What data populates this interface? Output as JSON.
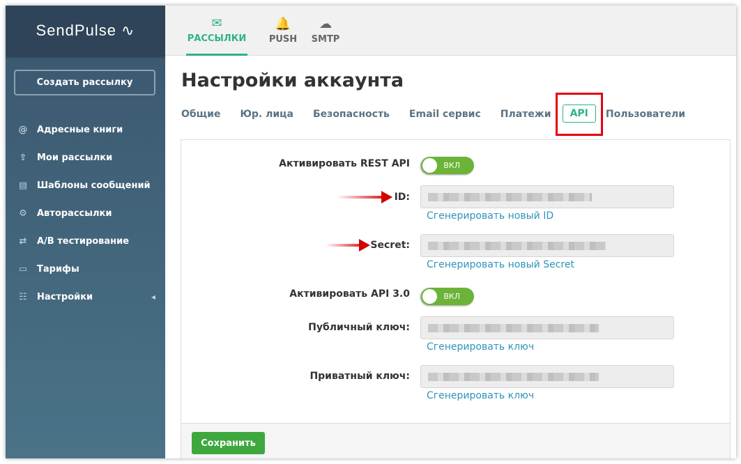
{
  "logo": "SendPulse",
  "sidebar": {
    "create_label": "Создать рассылку",
    "items": [
      {
        "label": "Адресные книги",
        "icon": "address-book-icon",
        "glyph": "@"
      },
      {
        "label": "Мои рассылки",
        "icon": "send-icon",
        "glyph": "⇪"
      },
      {
        "label": "Шаблоны сообщений",
        "icon": "template-icon",
        "glyph": "▤"
      },
      {
        "label": "Авторассылки",
        "icon": "automation-icon",
        "glyph": "⚙"
      },
      {
        "label": "A/B тестирование",
        "icon": "ab-test-icon",
        "glyph": "⇄"
      },
      {
        "label": "Тарифы",
        "icon": "wallet-icon",
        "glyph": "▭"
      },
      {
        "label": "Настройки",
        "icon": "settings-sliders-icon",
        "glyph": "☷"
      }
    ]
  },
  "topnav": [
    {
      "label": "РАССЫЛКИ",
      "glyph": "✉"
    },
    {
      "label": "PUSH",
      "glyph": "🔔"
    },
    {
      "label": "SMTP",
      "glyph": "☁"
    }
  ],
  "title": "Настройки аккаунта",
  "tabs": [
    "Общие",
    "Юр. лица",
    "Безопасность",
    "Email сервис",
    "Платежи",
    "API",
    "Пользователи"
  ],
  "form": {
    "rest_label": "Активировать REST API",
    "toggle_on": "ВКЛ",
    "id_label": "ID:",
    "id_link": "Сгенерировать новый ID",
    "secret_label": "Secret:",
    "secret_link": "Сгенерировать новый Secret",
    "api3_label": "Активировать API 3.0",
    "public_label": "Публичный ключ:",
    "public_link": "Сгенерировать ключ",
    "private_label": "Приватный ключ:",
    "private_link": "Сгенерировать ключ"
  },
  "save_label": "Сохранить",
  "colors": {
    "accent": "#2fb287",
    "save": "#3ea83e",
    "link": "#2d93b8",
    "highlight": "#e3000f"
  }
}
